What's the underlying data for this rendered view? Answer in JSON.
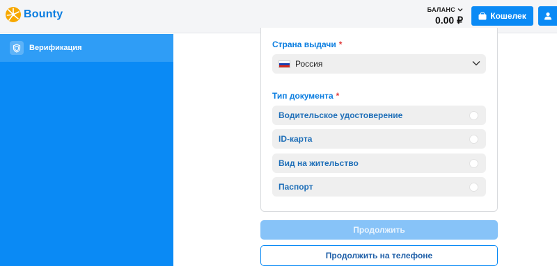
{
  "header": {
    "logo_text": "Bounty",
    "balance_label": "БАЛАНС",
    "balance_value": "0.00 ₽",
    "wallet_label": "Кошелек"
  },
  "sidebar": {
    "items": [
      {
        "label": "Верификация",
        "icon": "shield-icon"
      }
    ]
  },
  "form": {
    "country_label": "Страна выдачи",
    "required_mark": "*",
    "country_value": "Россия",
    "doc_type_label": "Тип документа",
    "doc_options": [
      {
        "label": "Водительское удостоверение",
        "selected": false
      },
      {
        "label": "ID-карта",
        "selected": false
      },
      {
        "label": "Вид на жительство",
        "selected": false
      },
      {
        "label": "Паспорт",
        "selected": false
      }
    ],
    "continue_label": "Продолжить",
    "continue_on_phone_label": "Продолжить на телефоне"
  },
  "colors": {
    "brand_blue": "#0a8af5",
    "label_blue": "#0a7de0",
    "required_red": "#e03a3a",
    "disabled_button": "#87c3f8"
  }
}
